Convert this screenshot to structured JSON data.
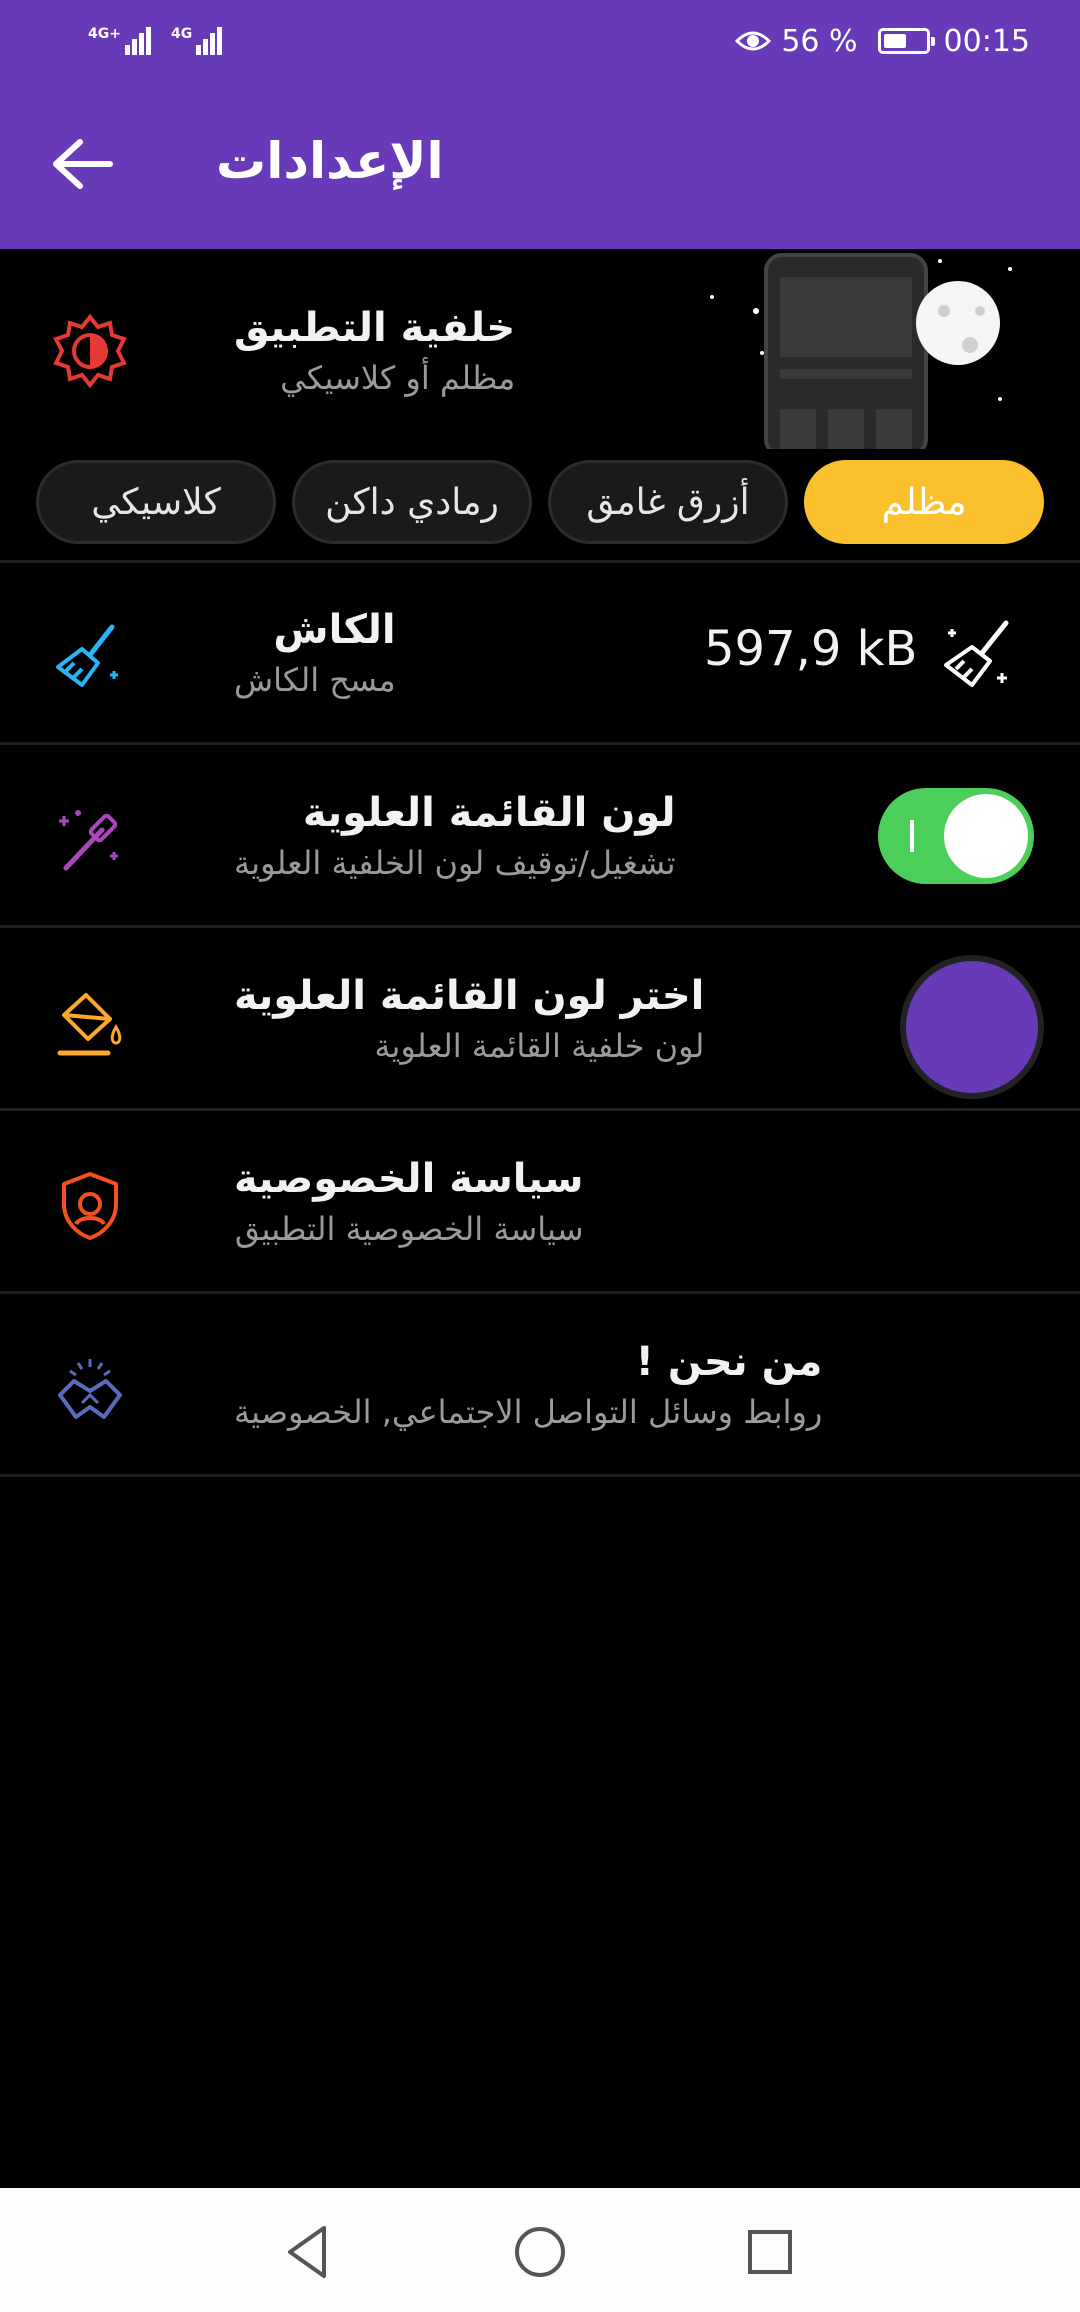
{
  "status_bar": {
    "network_1": "4G+",
    "network_2": "4G",
    "battery_percent": "56 %",
    "battery_level": 0.56,
    "time": "00:15",
    "eye_icon": "eye-icon"
  },
  "app_bar": {
    "title": "الإعدادات",
    "back_icon": "arrow-left-icon",
    "color": "#673ab7"
  },
  "settings": {
    "theme": {
      "title": "خلفية التطبيق",
      "subtitle": "مظلم أو كلاسيكي",
      "options": [
        {
          "label": "مظلم",
          "selected": true
        },
        {
          "label": "أزرق غامق",
          "selected": false
        },
        {
          "label": "رمادي داكن",
          "selected": false
        },
        {
          "label": "كلاسيكي",
          "selected": false
        }
      ],
      "accent": "#fbc02d"
    },
    "cache": {
      "title": "الكاش",
      "subtitle": "مسح الكاش",
      "size": "597,9 kB"
    },
    "toolbar_color": {
      "title": "لون القائمة العلوية",
      "subtitle": "تشغيل/توقيف لون الخلفية العلوية",
      "enabled": true
    },
    "pick_color": {
      "title": "اختر لون القائمة العلوية",
      "subtitle": "لون خلفية القائمة العلوية",
      "color": "#673ab7"
    },
    "privacy": {
      "title": "سياسة الخصوصية",
      "subtitle": "سياسة الخصوصية التطبيق"
    },
    "about": {
      "title": "من نحن !",
      "subtitle": "روابط وسائل التواصل الاجتماعي, الخصوصية"
    }
  },
  "nav_bar": {
    "back": "triangle-back-icon",
    "home": "circle-home-icon",
    "recents": "square-recents-icon"
  }
}
